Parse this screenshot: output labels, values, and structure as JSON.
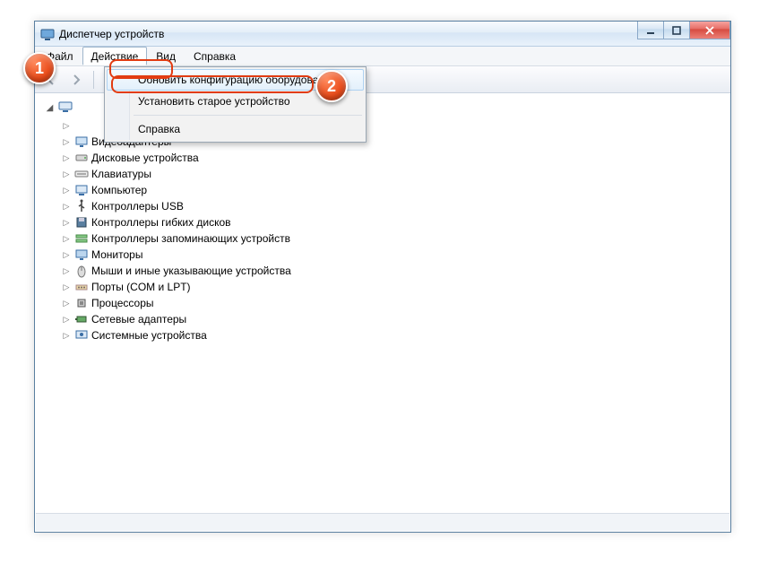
{
  "window": {
    "title": "Диспетчер устройств"
  },
  "menubar": {
    "file": "Файл",
    "action": "Действие",
    "view": "Вид",
    "help": "Справка"
  },
  "dropdown": {
    "scan": "Обновить конфигурацию оборудования",
    "legacy": "Установить старое устройство",
    "help": "Справка"
  },
  "tree": {
    "items": [
      {
        "label": "",
        "icon": "hidden"
      },
      {
        "label": "Видеоадаптеры",
        "icon": "display"
      },
      {
        "label": "Дисковые устройства",
        "icon": "disk"
      },
      {
        "label": "Клавиатуры",
        "icon": "keyboard"
      },
      {
        "label": "Компьютер",
        "icon": "computer"
      },
      {
        "label": "Контроллеры USB",
        "icon": "usb"
      },
      {
        "label": "Контроллеры гибких дисков",
        "icon": "floppy"
      },
      {
        "label": "Контроллеры запоминающих устройств",
        "icon": "storage"
      },
      {
        "label": "Мониторы",
        "icon": "monitor"
      },
      {
        "label": "Мыши и иные указывающие устройства",
        "icon": "mouse"
      },
      {
        "label": "Порты (COM и LPT)",
        "icon": "port"
      },
      {
        "label": "Процессоры",
        "icon": "cpu"
      },
      {
        "label": "Сетевые адаптеры",
        "icon": "network"
      },
      {
        "label": "Системные устройства",
        "icon": "system"
      }
    ]
  },
  "callouts": {
    "one": "1",
    "two": "2"
  }
}
